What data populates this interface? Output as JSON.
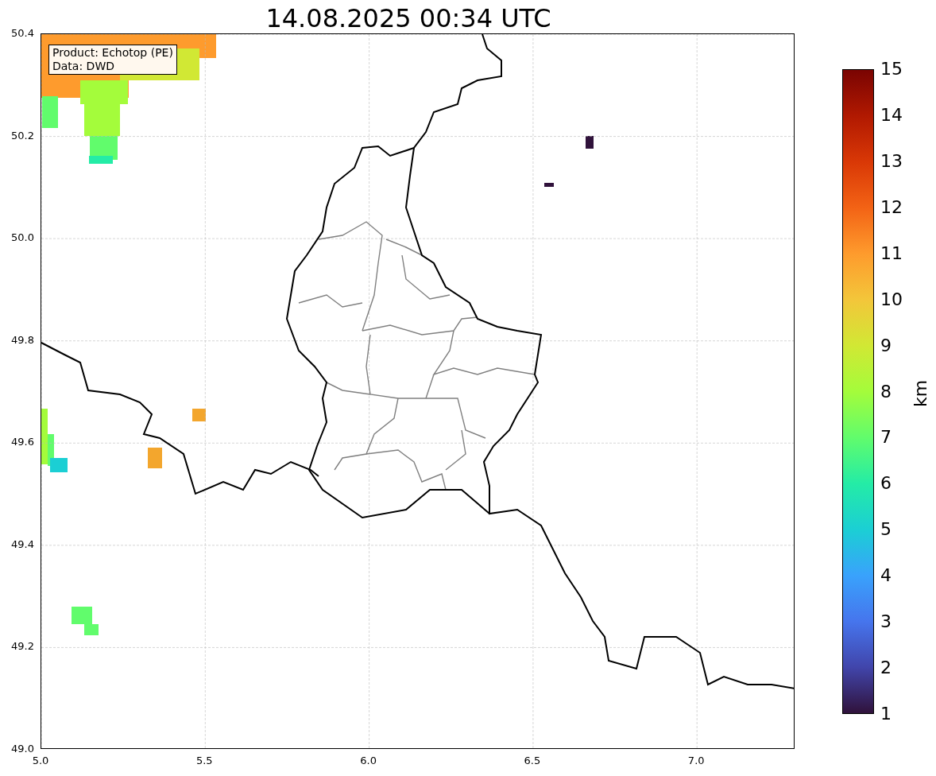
{
  "title": "14.08.2025 00:34 UTC",
  "annotation": {
    "lines": [
      "Product: Echotop (PE)",
      "Data: DWD"
    ]
  },
  "axes": {
    "xticks": [
      "5.0",
      "5.5",
      "6.0",
      "6.5",
      "7.0"
    ],
    "yticks": [
      "50.4",
      "50.2",
      "50.0",
      "49.8",
      "49.6",
      "49.4",
      "49.2",
      "49.0"
    ]
  },
  "colorbar": {
    "label": "km",
    "ticks": [
      "15",
      "14",
      "13",
      "12",
      "11",
      "10",
      "9",
      "8",
      "7",
      "6",
      "5",
      "4",
      "3",
      "2",
      "1"
    ]
  }
}
